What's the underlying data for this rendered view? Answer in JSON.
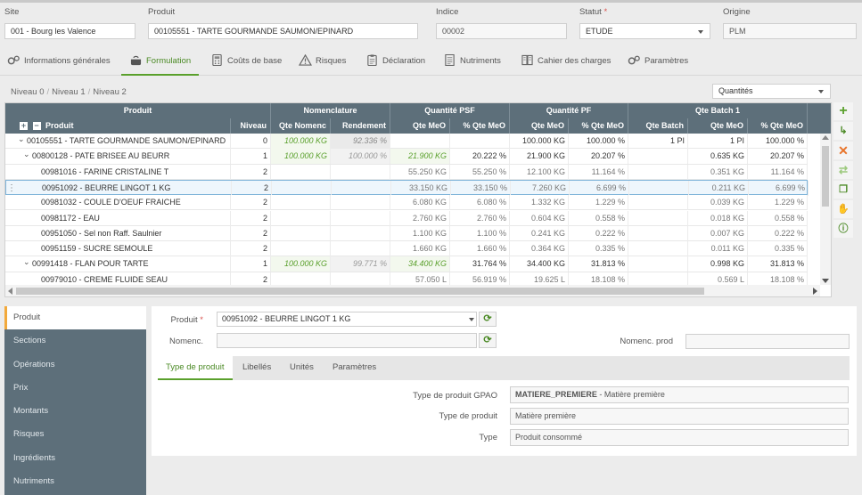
{
  "header": {
    "site": {
      "label": "Site",
      "value": "001 - Bourg les Valence"
    },
    "produit": {
      "label": "Produit",
      "value": "00105551 - TARTE GOURMANDE SAUMON/EPINARD"
    },
    "indice": {
      "label": "Indice",
      "value": "00002"
    },
    "statut": {
      "label": "Statut",
      "required": "*",
      "value": "ETUDE"
    },
    "origine": {
      "label": "Origine",
      "value": "PLM"
    }
  },
  "tabs": [
    {
      "label": "Informations générales",
      "icon": "gears-icon"
    },
    {
      "label": "Formulation",
      "icon": "cooking-pot-icon"
    },
    {
      "label": "Coûts de base",
      "icon": "calculator-icon"
    },
    {
      "label": "Risques",
      "icon": "warning-icon"
    },
    {
      "label": "Déclaration",
      "icon": "clipboard-icon"
    },
    {
      "label": "Nutriments",
      "icon": "document-icon"
    },
    {
      "label": "Cahier des charges",
      "icon": "book-icon"
    },
    {
      "label": "Paramètres",
      "icon": "gears-icon"
    }
  ],
  "breadcrumb": [
    "Niveau 0",
    "Niveau 1",
    "Niveau 2"
  ],
  "quantites_select": "Quantités",
  "grid": {
    "group_headers": [
      "Produit",
      "Nomenclature",
      "Quantité PSF",
      "Quantité PF",
      "Qte Batch 1"
    ],
    "columns": [
      "Produit",
      "Niveau",
      "Qte Nomenc",
      "Rendement",
      "Qte MeO",
      "% Qte MeO",
      "Qte MeO",
      "% Qte MeO",
      "Qte Batch",
      "Qte MeO",
      "% Qte MeO"
    ],
    "rows": [
      {
        "prod": "00105551 - TARTE GOURMANDE SAUMON/EPINARD",
        "niv": "0",
        "qn": "100.000 KG",
        "rend": "92.336 %",
        "psf": "",
        "psfp": "",
        "pf": "100.000 KG",
        "pfp": "100.000 %",
        "batch": "1 PI",
        "bq": "1 PI",
        "bqp": "100.000 %"
      },
      {
        "prod": "00800128 - PATE BRISEE AU BEURR",
        "niv": "1",
        "qn": "100.000 KG",
        "rend": "100.000 %",
        "psf": "21.900 KG",
        "psfp": "20.222 %",
        "pf": "21.900 KG",
        "pfp": "20.207 %",
        "batch": "",
        "bq": "0.635 KG",
        "bqp": "20.207 %"
      },
      {
        "prod": "00981016 - FARINE CRISTALINE T",
        "niv": "2",
        "qn": "",
        "rend": "",
        "psf": "55.250 KG",
        "psfp": "55.250 %",
        "pf": "12.100 KG",
        "pfp": "11.164 %",
        "batch": "",
        "bq": "0.351 KG",
        "bqp": "11.164 %"
      },
      {
        "prod": "00951092 - BEURRE LINGOT 1 KG",
        "niv": "2",
        "qn": "",
        "rend": "",
        "psf": "33.150 KG",
        "psfp": "33.150 %",
        "pf": "7.260 KG",
        "pfp": "6.699 %",
        "batch": "",
        "bq": "0.211 KG",
        "bqp": "6.699 %"
      },
      {
        "prod": "00981032 - COULE D'OEUF FRAICHE",
        "niv": "2",
        "qn": "",
        "rend": "",
        "psf": "6.080 KG",
        "psfp": "6.080 %",
        "pf": "1.332 KG",
        "pfp": "1.229 %",
        "batch": "",
        "bq": "0.039 KG",
        "bqp": "1.229 %"
      },
      {
        "prod": "00981172 - EAU",
        "niv": "2",
        "qn": "",
        "rend": "",
        "psf": "2.760 KG",
        "psfp": "2.760 %",
        "pf": "0.604 KG",
        "pfp": "0.558 %",
        "batch": "",
        "bq": "0.018 KG",
        "bqp": "0.558 %"
      },
      {
        "prod": "00951050 - Sel non Raff. Saulnier",
        "niv": "2",
        "qn": "",
        "rend": "",
        "psf": "1.100 KG",
        "psfp": "1.100 %",
        "pf": "0.241 KG",
        "pfp": "0.222 %",
        "batch": "",
        "bq": "0.007 KG",
        "bqp": "0.222 %"
      },
      {
        "prod": "00951159 - SUCRE SEMOULE",
        "niv": "2",
        "qn": "",
        "rend": "",
        "psf": "1.660 KG",
        "psfp": "1.660 %",
        "pf": "0.364 KG",
        "pfp": "0.335 %",
        "batch": "",
        "bq": "0.011 KG",
        "bqp": "0.335 %"
      },
      {
        "prod": "00991418 - FLAN POUR TARTE",
        "niv": "1",
        "qn": "100.000 KG",
        "rend": "99.771 %",
        "psf": "34.400 KG",
        "psfp": "31.764 %",
        "pf": "34.400 KG",
        "pfp": "31.813 %",
        "batch": "",
        "bq": "0.998 KG",
        "bqp": "31.813 %"
      },
      {
        "prod": "00979010 - CREME FLUIDE SEAU",
        "niv": "2",
        "qn": "",
        "rend": "",
        "psf": "57.050 L",
        "psfp": "56.919 %",
        "pf": "19.625 L",
        "pfp": "18.108 %",
        "batch": "",
        "bq": "0.569 L",
        "bqp": "18.108 %"
      }
    ]
  },
  "left_nav": [
    "Produit",
    "Sections",
    "Opérations",
    "Prix",
    "Montants",
    "Risques",
    "Ingrédients",
    "Nutriments"
  ],
  "detail": {
    "produit_label": "Produit",
    "required": "*",
    "produit_value": "00951092 - BEURRE LINGOT 1 KG",
    "nomenc_label": "Nomenc.",
    "nomenc_value": "",
    "nomenc_prod_label": "Nomenc. prod",
    "nomenc_prod_value": "",
    "subtabs": [
      "Type de produit",
      "Libellés",
      "Unités",
      "Paramètres"
    ],
    "type_gpao_label": "Type de produit GPAO",
    "type_gpao_code": "MATIERE_PREMIERE",
    "type_gpao_text": " - Matière première",
    "type_label": "Type de produit",
    "type_value": "Matière première",
    "type2_label": "Type",
    "type2_value": "Produit consommé"
  },
  "colors": {
    "accent": "#5aa02c",
    "header_bg": "#5d6f7a",
    "nav_active_border": "#f2a93b",
    "delete": "#e8742a"
  }
}
